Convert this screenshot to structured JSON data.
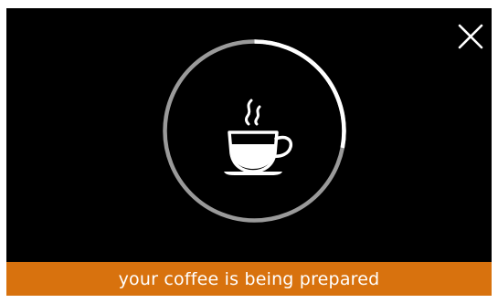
{
  "status": {
    "message": "your coffee is being prepared"
  },
  "progress": {
    "fraction": 0.28
  },
  "colors": {
    "background": "#000000",
    "status_bar": "#d8720e",
    "progress_fill": "#ffffff",
    "progress_track": "#9a9a9a",
    "text": "#ffffff"
  },
  "icons": {
    "close": "close-icon",
    "cup": "coffee-cup-icon"
  }
}
